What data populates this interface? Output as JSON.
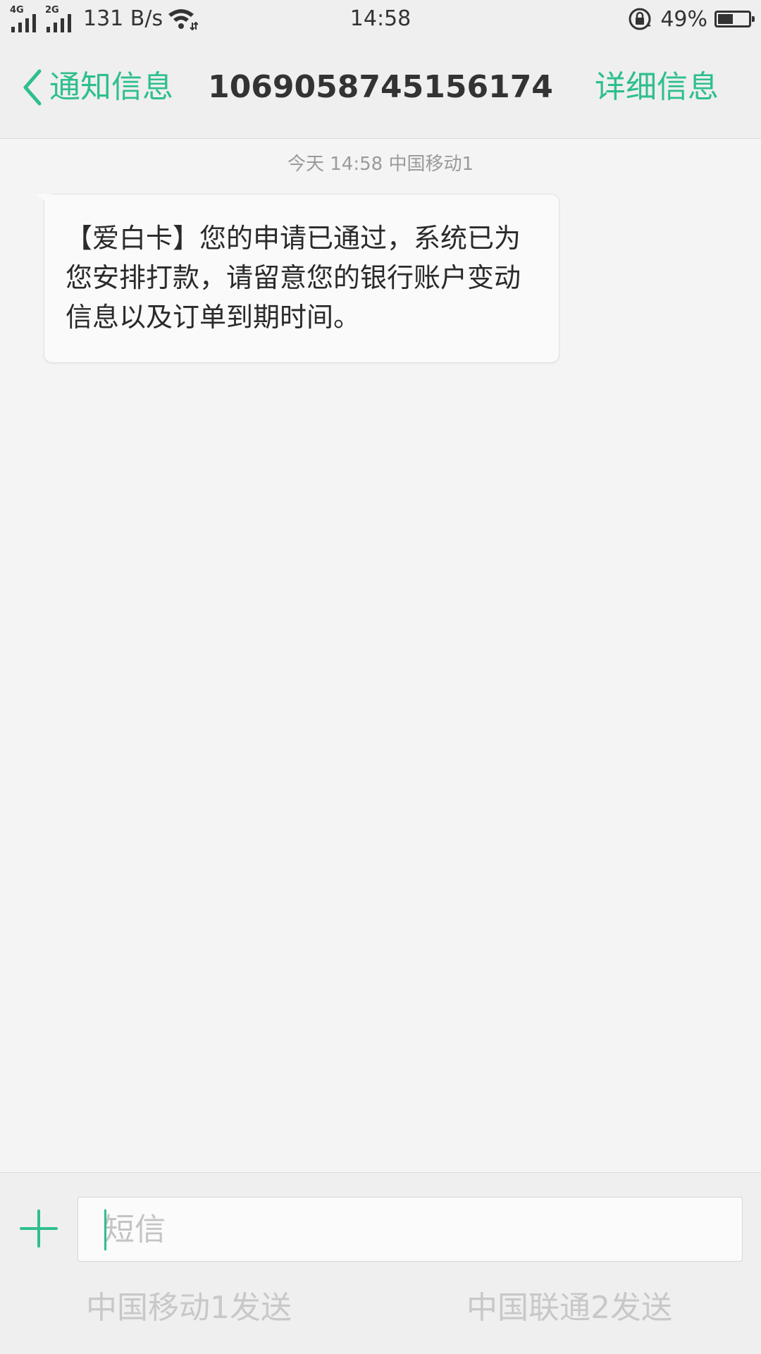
{
  "status_bar": {
    "net1_label": "4G",
    "net2_label": "2G",
    "speed": "131 B/s",
    "time": "14:58",
    "battery_percent_text": "49%",
    "battery_level": 0.49
  },
  "header": {
    "back_label": "通知信息",
    "title": "1069058745156174",
    "detail_label": "详细信息"
  },
  "conversation": {
    "meta": "今天 14:58  中国移动1",
    "messages": [
      {
        "text": "【爱白卡】您的申请已通过，系统已为您安排打款，请留意您的银行账户变动信息以及订单到期时间。"
      }
    ]
  },
  "compose": {
    "placeholder": "短信",
    "value": "",
    "send_sim1": "中国移动1发送",
    "send_sim2": "中国联通2发送"
  },
  "colors": {
    "accent": "#2ebf8c",
    "background": "#f4f4f4",
    "bar_background": "#efefef"
  },
  "icons": {
    "back": "chevron-left-icon",
    "add": "plus-icon",
    "wifi": "wifi-icon",
    "rotation_lock": "rotation-lock-icon",
    "battery": "battery-icon"
  }
}
